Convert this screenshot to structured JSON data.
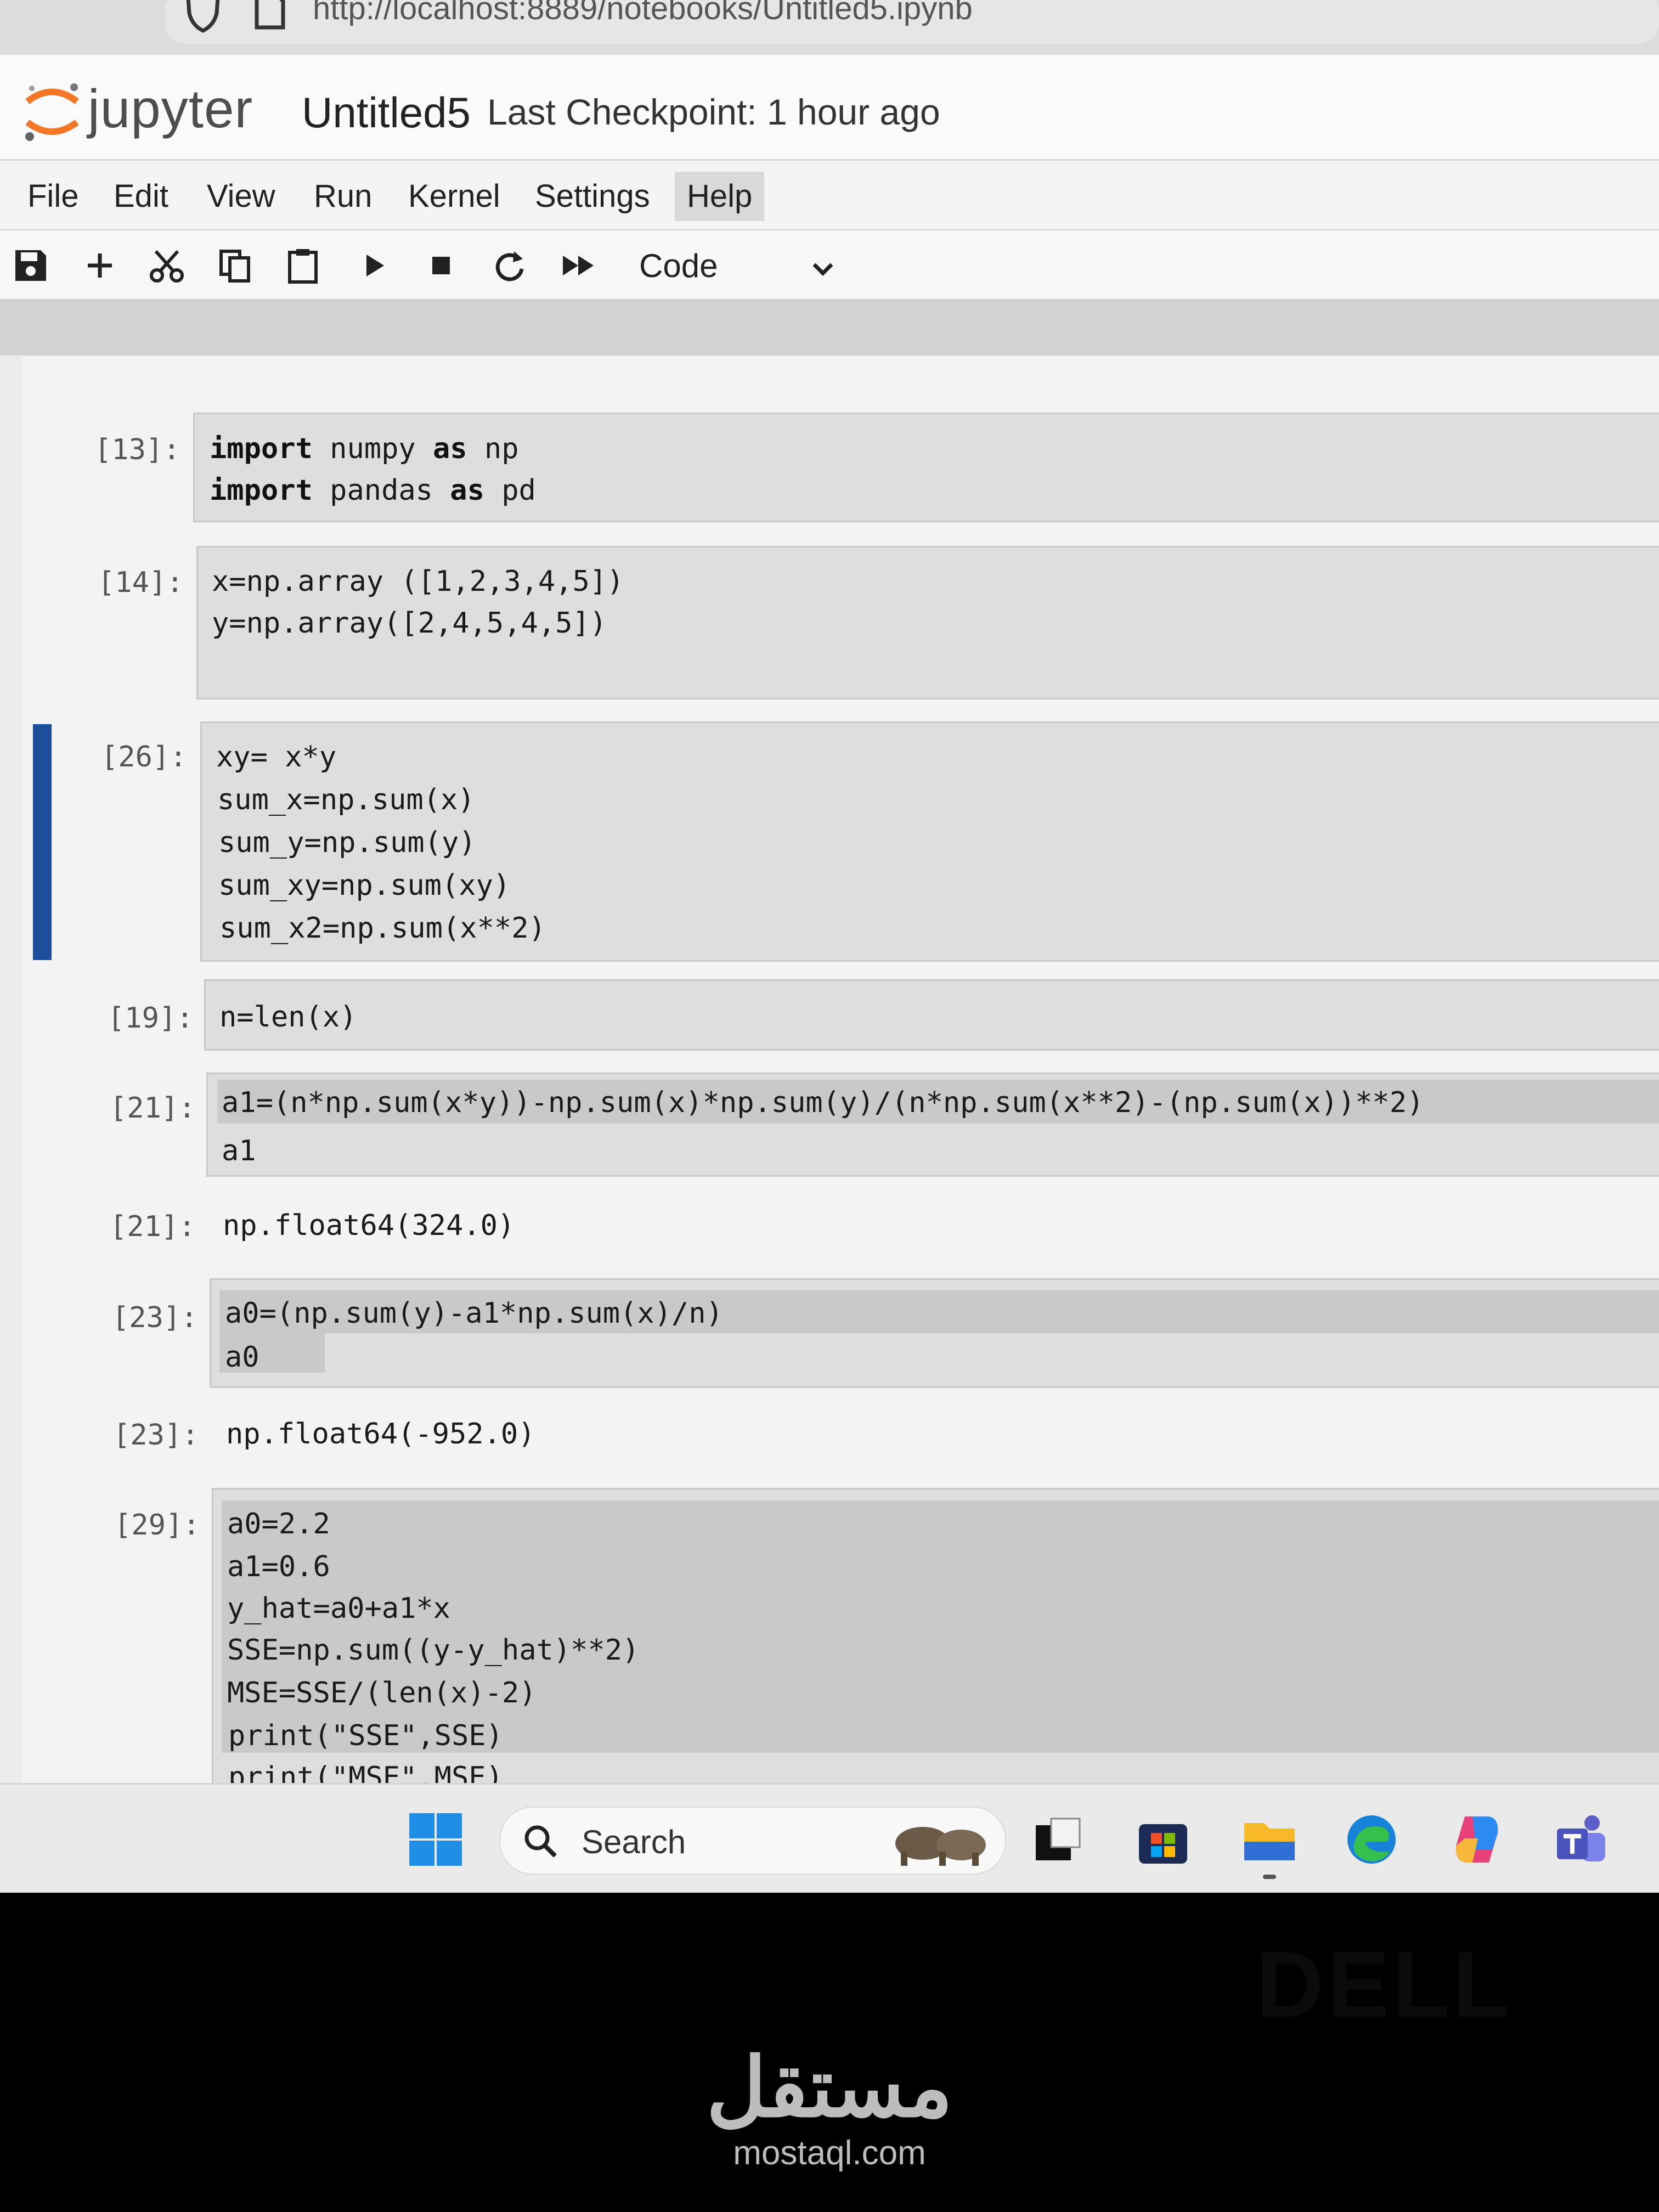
{
  "browser": {
    "url": "http://localhost:8889/notebooks/Untitled5.ipynb"
  },
  "header": {
    "logo_text": "jupyter",
    "notebook_title": "Untitled5",
    "checkpoint": "Last Checkpoint: 1 hour ago"
  },
  "menu": [
    "File",
    "Edit",
    "View",
    "Run",
    "Kernel",
    "Settings",
    "Help"
  ],
  "toolbar": {
    "icons": [
      "save-icon",
      "add-icon",
      "cut-icon",
      "copy-icon",
      "paste-icon",
      "run-icon",
      "stop-icon",
      "restart-icon",
      "fast-forward-icon"
    ],
    "cell_type": "Code"
  },
  "cells": [
    {
      "prompt": "[13]:",
      "lines": [
        "import numpy as np",
        "import pandas as pd"
      ]
    },
    {
      "prompt": "[14]:",
      "lines": [
        "x=np.array ([1,2,3,4,5])",
        "y=np.array([2,4,5,4,5])"
      ]
    },
    {
      "prompt": "[26]:",
      "lines": [
        "xy= x*y",
        "sum_x=np.sum(x)",
        "sum_y=np.sum(y)",
        "sum_xy=np.sum(xy)",
        "sum_x2=np.sum(x**2)"
      ]
    },
    {
      "prompt": "[19]:",
      "lines": [
        "n=len(x)"
      ]
    },
    {
      "prompt": "[21]:",
      "lines": [
        "a1=(n*np.sum(x*y))-np.sum(x)*np.sum(y)/(n*np.sum(x**2)-(np.sum(x))**2)",
        "a1"
      ],
      "output_prompt": "[21]:",
      "output": "np.float64(324.0)"
    },
    {
      "prompt": "[23]:",
      "lines": [
        "a0=(np.sum(y)-a1*np.sum(x)/n)",
        "a0"
      ],
      "output_prompt": "[23]:",
      "output": "np.float64(-952.0)"
    },
    {
      "prompt": "[29]:",
      "lines": [
        "a0=2.2",
        "a1=0.6",
        "y_hat=a0+a1*x",
        "SSE=np.sum((y-y_hat)**2)",
        "MSE=SSE/(len(x)-2)",
        "print(\"SSE\",SSE)",
        "print(\"MSE\",MSE)"
      ]
    }
  ],
  "taskbar": {
    "search_label": "Search",
    "icons": [
      "windows-start-icon",
      "search-icon",
      "elephants-widget-icon",
      "task-view-icon",
      "store-icon",
      "file-explorer-icon",
      "edge-icon",
      "copilot-icon",
      "teams-icon"
    ]
  },
  "bezel": {
    "brand": "DELL"
  },
  "watermark": {
    "arabic": "مستقل",
    "latin": "mostaql.com"
  }
}
